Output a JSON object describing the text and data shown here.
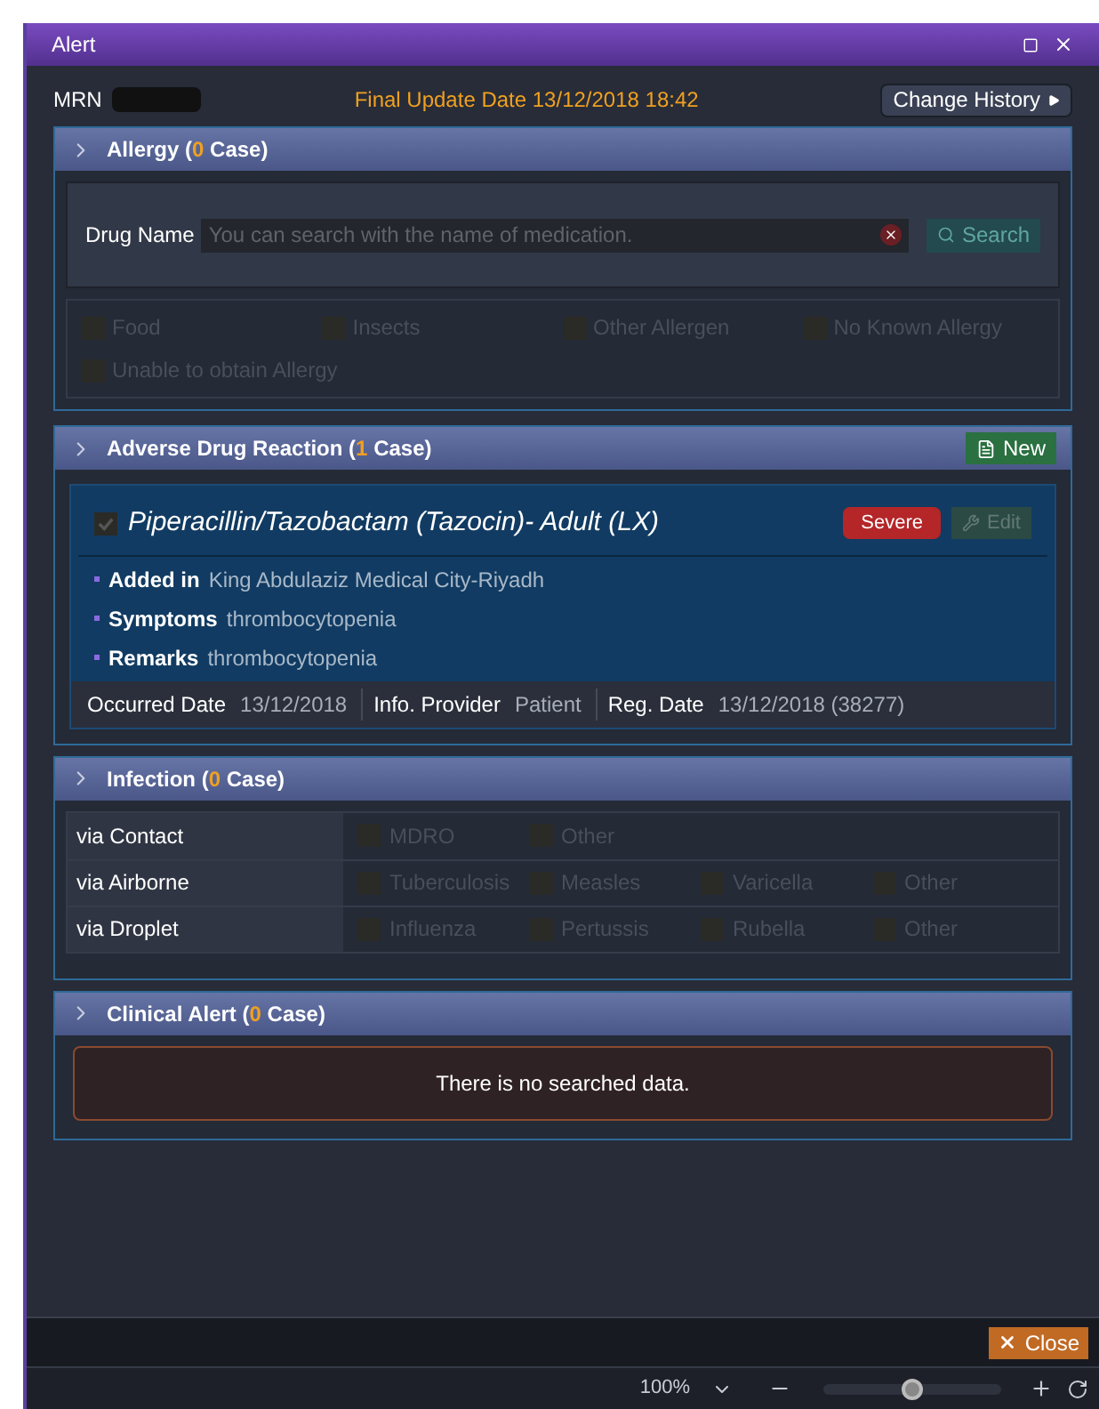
{
  "window": {
    "title": "Alert"
  },
  "header": {
    "mrn_label": "MRN",
    "final_update": "Final Update Date 13/12/2018 18:42",
    "change_history": "Change History"
  },
  "allergy": {
    "title": "Allergy (",
    "count": "0",
    "title_end": " Case)",
    "drug_label": "Drug Name",
    "search_placeholder": "You can search with the name of medication.",
    "search_button": "Search",
    "options": [
      {
        "label": "Food",
        "checked": false
      },
      {
        "label": "Insects",
        "checked": false
      },
      {
        "label": "Other Allergen",
        "checked": false
      },
      {
        "label": "No Known Allergy",
        "checked": false
      },
      {
        "label": "Unable to obtain Allergy",
        "checked": false
      }
    ]
  },
  "adverse": {
    "title": "Adverse Drug Reaction (",
    "count": "1",
    "title_end": " Case)",
    "new_button": "New",
    "items": [
      {
        "drug": "Piperacillin/Tazobactam (Tazocin)- Adult (LX)",
        "checked": true,
        "severity": "Severe",
        "edit": "Edit",
        "details": [
          {
            "label": "Added in",
            "value": "King Abdulaziz Medical City-Riyadh"
          },
          {
            "label": "Symptoms",
            "value": "thrombocytopenia"
          },
          {
            "label": "Remarks",
            "value": "thrombocytopenia"
          }
        ],
        "footer": [
          {
            "label": "Occurred Date",
            "value": "13/12/2018"
          },
          {
            "label": "Info. Provider",
            "value": "Patient"
          },
          {
            "label": "Reg. Date",
            "value": "13/12/2018 (38277)"
          }
        ]
      }
    ]
  },
  "infection": {
    "title": "Infection (",
    "count": "0",
    "title_end": " Case)",
    "rows": [
      {
        "route": "via Contact",
        "options": [
          {
            "label": "MDRO",
            "checked": false
          },
          {
            "label": "Other",
            "checked": false
          }
        ]
      },
      {
        "route": "via Airborne",
        "options": [
          {
            "label": "Tuberculosis",
            "checked": false
          },
          {
            "label": "Measles",
            "checked": false
          },
          {
            "label": "Varicella",
            "checked": false
          },
          {
            "label": "Other",
            "checked": false
          }
        ]
      },
      {
        "route": "via Droplet",
        "options": [
          {
            "label": "Influenza",
            "checked": false
          },
          {
            "label": "Pertussis",
            "checked": false
          },
          {
            "label": "Rubella",
            "checked": false
          },
          {
            "label": "Other",
            "checked": false
          }
        ]
      }
    ]
  },
  "clinical": {
    "title": "Clinical Alert (",
    "count": "0",
    "title_end": " Case)",
    "empty": "There is no searched data."
  },
  "footer": {
    "close": "Close"
  },
  "status_bar": {
    "zoom": "100%",
    "zoom_slider": {
      "level": 0.5
    }
  }
}
